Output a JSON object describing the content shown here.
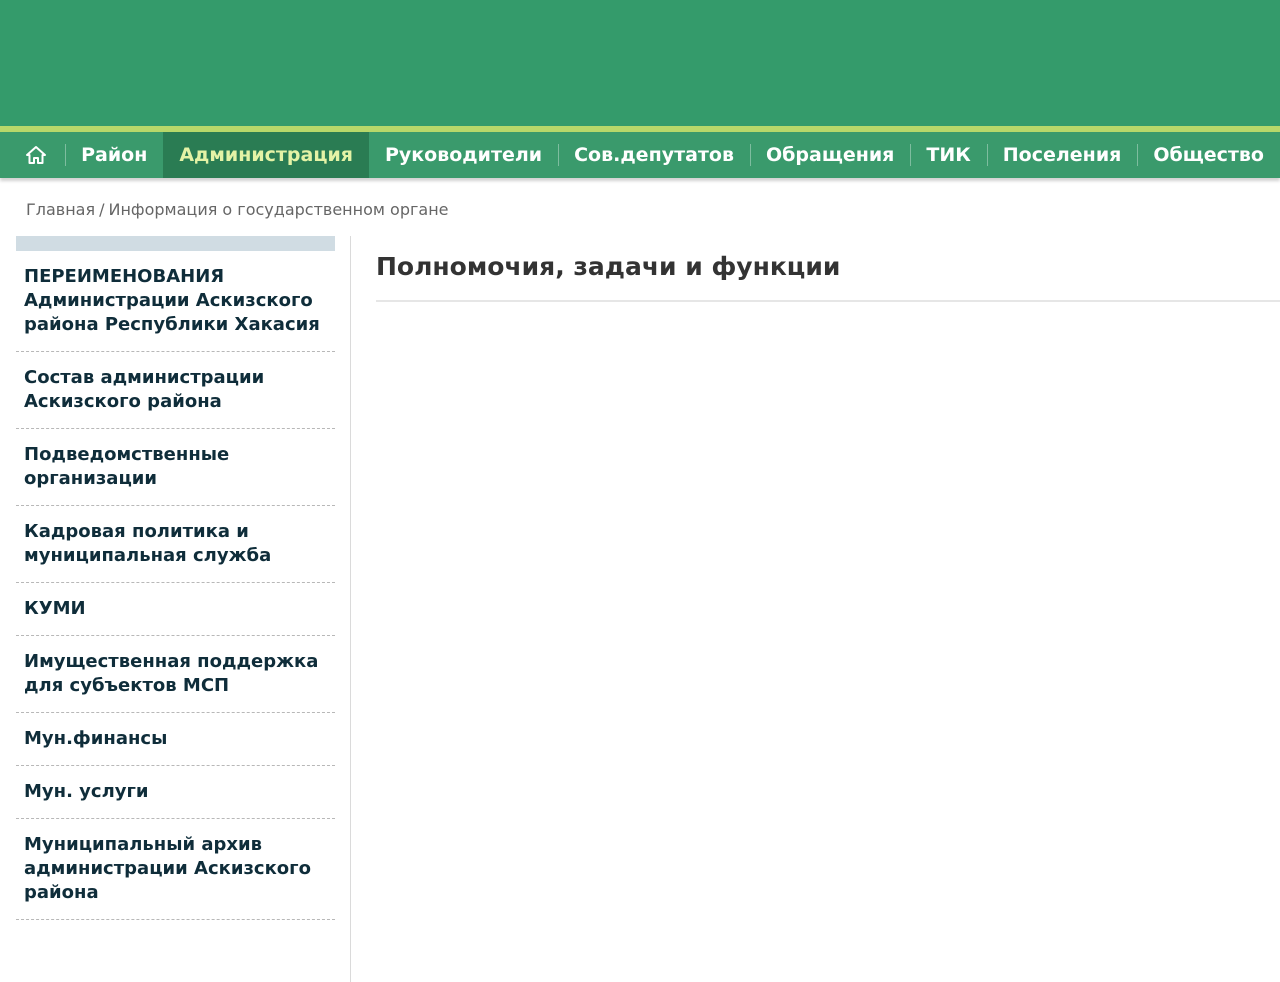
{
  "nav": {
    "home_icon": "home-icon",
    "items": [
      {
        "label": "Район"
      },
      {
        "label": "Администрация"
      },
      {
        "label": "Руководители"
      },
      {
        "label": "Сов.депутатов"
      },
      {
        "label": "Обращения"
      },
      {
        "label": "ТИК"
      },
      {
        "label": "Поселения"
      },
      {
        "label": "Общество"
      }
    ],
    "active_label": "Администрация"
  },
  "breadcrumb": {
    "home": "Главная",
    "separator": "/",
    "current": "Информация о государственном органе"
  },
  "sidebar": {
    "items": [
      {
        "label": "ПЕРЕИМЕНОВАНИЯ Администрации Аскизского района Республики Хакасия"
      },
      {
        "label": "Состав администрации Аскизского района"
      },
      {
        "label": "Подведомственные организации"
      },
      {
        "label": "Кадровая политика и муниципальная служба"
      },
      {
        "label": "КУМИ"
      },
      {
        "label": "Имущественная поддержка для субъектов МСП"
      },
      {
        "label": "Мун.финансы"
      },
      {
        "label": "Мун. услуги"
      },
      {
        "label": "Муниципальный архив администрации Аскизского района"
      }
    ]
  },
  "main": {
    "title": "Полномочия, задачи и функции"
  },
  "colors": {
    "header_green": "#349b6b",
    "stripe": "#b7d86a",
    "nav_active": "#2a7c53",
    "nav_active_text": "#e4f3a6",
    "sidebar_text": "#0f2d3a"
  }
}
